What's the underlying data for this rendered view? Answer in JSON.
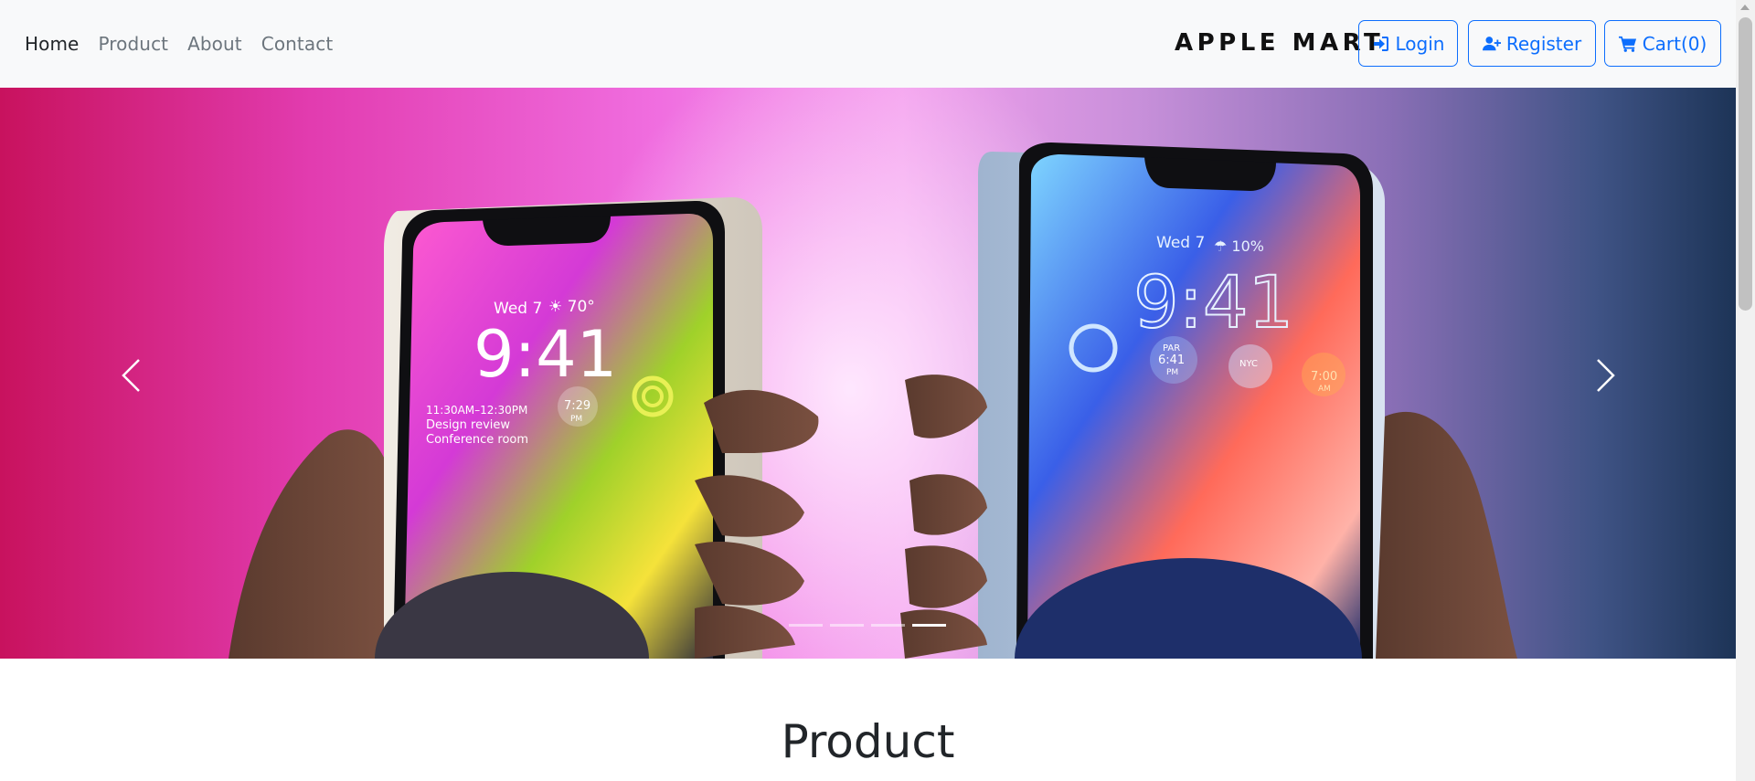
{
  "nav": {
    "items": [
      {
        "label": "Home",
        "active": true
      },
      {
        "label": "Product",
        "active": false
      },
      {
        "label": "About",
        "active": false
      },
      {
        "label": "Contact",
        "active": false
      }
    ]
  },
  "brand": "APPLE MART",
  "actions": {
    "login": "Login",
    "register": "Register",
    "cart": "Cart(0)"
  },
  "icons": {
    "login": "sign-in-icon",
    "register": "user-plus-icon",
    "cart": "shopping-cart-icon",
    "prev": "chevron-left-icon",
    "next": "chevron-right-icon"
  },
  "colors": {
    "primary": "#0d6efd",
    "navbar_bg": "#f8f9fa",
    "nav_text": "#6c757d",
    "nav_active": "#212529"
  },
  "carousel": {
    "slide_count": 4,
    "active_index": 3,
    "phones": [
      {
        "date": "Wed 7",
        "weather": "☀ 70°",
        "time": "9:41",
        "event_time": "11:30AM–12:30PM",
        "event_title": "Design review",
        "event_location": "Conference room",
        "widget_time": "7:29",
        "widget_ampm": "PM"
      },
      {
        "date": "Wed 7",
        "weather": "☂ 10%",
        "time": "9:41",
        "widget_city": "PAR",
        "widget_city_time": "6:41",
        "widget_city_ampm": "PM",
        "widget_clock": "NYC",
        "widget_alarm": "7:00",
        "widget_alarm_ampm": "AM"
      }
    ]
  },
  "section": {
    "title": "Product"
  }
}
